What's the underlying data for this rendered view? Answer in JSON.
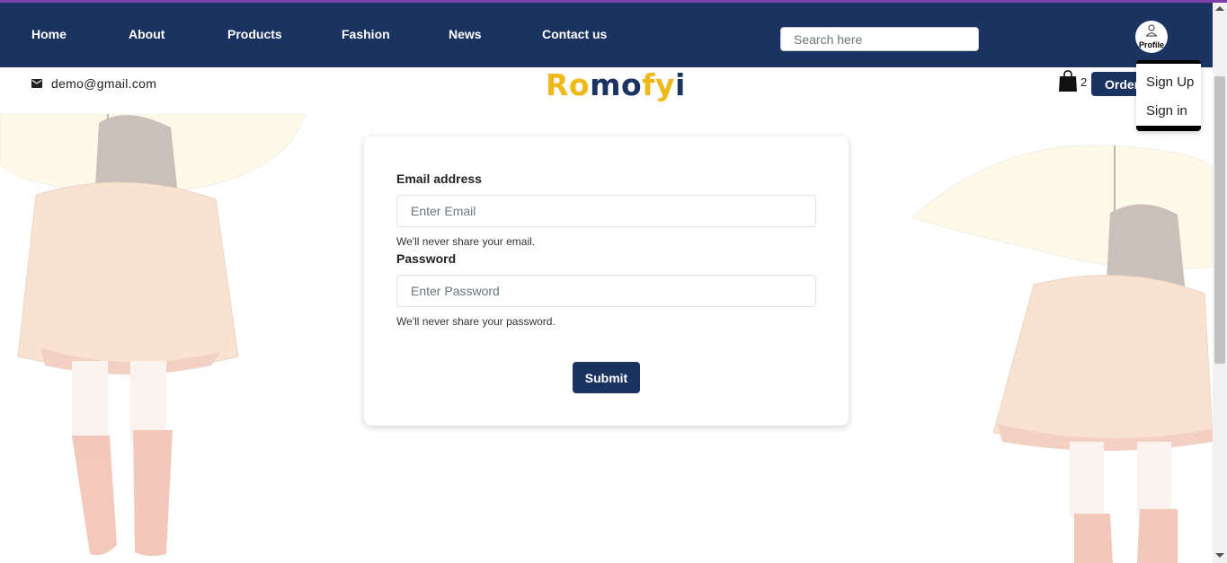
{
  "nav": {
    "links": [
      "Home",
      "About",
      "Products",
      "Fashion",
      "News",
      "Contact us"
    ],
    "search_placeholder": "Search here",
    "profile_label": "Profile"
  },
  "dropdown": {
    "sign_up": "Sign Up",
    "sign_in": "Sign in"
  },
  "subheader": {
    "email": "demo@gmail.com",
    "logo": "Romofyi",
    "cart_count": "2",
    "order_label": "Order"
  },
  "form": {
    "email_label": "Email address",
    "email_placeholder": "Enter Email",
    "email_help": "We'll never share your email.",
    "password_label": "Password",
    "password_placeholder": "Enter Password",
    "password_help": "We'll never share your password.",
    "submit_label": "Submit"
  },
  "colors": {
    "navbar": "#1a3361",
    "accent_yellow": "#f0b91a",
    "button": "#1a3361"
  }
}
